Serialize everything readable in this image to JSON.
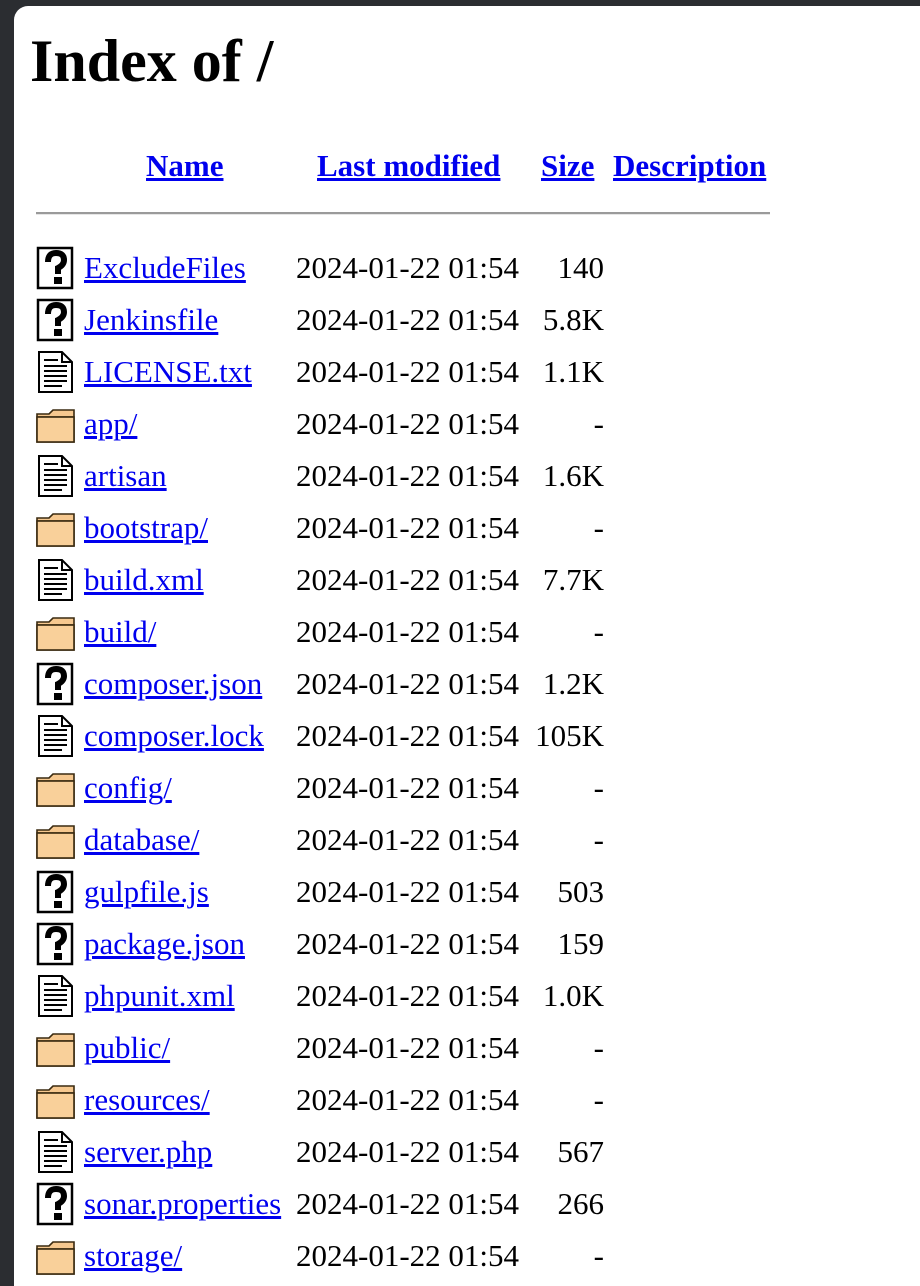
{
  "page": {
    "title": "Index of /"
  },
  "columns": {
    "name": "Name",
    "last_modified": "Last modified",
    "size": "Size",
    "description": "Description"
  },
  "entries": [
    {
      "name": "ExcludeFiles",
      "modified": "2024-01-22 01:54",
      "size": "140",
      "icon": "unknown-file-icon"
    },
    {
      "name": "Jenkinsfile",
      "modified": "2024-01-22 01:54",
      "size": "5.8K",
      "icon": "unknown-file-icon"
    },
    {
      "name": "LICENSE.txt",
      "modified": "2024-01-22 01:54",
      "size": "1.1K",
      "icon": "text-file-icon"
    },
    {
      "name": "app/",
      "modified": "2024-01-22 01:54",
      "size": "-",
      "icon": "folder-icon"
    },
    {
      "name": "artisan",
      "modified": "2024-01-22 01:54",
      "size": "1.6K",
      "icon": "text-file-icon"
    },
    {
      "name": "bootstrap/",
      "modified": "2024-01-22 01:54",
      "size": "-",
      "icon": "folder-icon"
    },
    {
      "name": "build.xml",
      "modified": "2024-01-22 01:54",
      "size": "7.7K",
      "icon": "text-file-icon"
    },
    {
      "name": "build/",
      "modified": "2024-01-22 01:54",
      "size": "-",
      "icon": "folder-icon"
    },
    {
      "name": "composer.json",
      "modified": "2024-01-22 01:54",
      "size": "1.2K",
      "icon": "unknown-file-icon"
    },
    {
      "name": "composer.lock",
      "modified": "2024-01-22 01:54",
      "size": "105K",
      "icon": "text-file-icon"
    },
    {
      "name": "config/",
      "modified": "2024-01-22 01:54",
      "size": "-",
      "icon": "folder-icon"
    },
    {
      "name": "database/",
      "modified": "2024-01-22 01:54",
      "size": "-",
      "icon": "folder-icon"
    },
    {
      "name": "gulpfile.js",
      "modified": "2024-01-22 01:54",
      "size": "503",
      "icon": "unknown-file-icon"
    },
    {
      "name": "package.json",
      "modified": "2024-01-22 01:54",
      "size": "159",
      "icon": "unknown-file-icon"
    },
    {
      "name": "phpunit.xml",
      "modified": "2024-01-22 01:54",
      "size": "1.0K",
      "icon": "text-file-icon"
    },
    {
      "name": "public/",
      "modified": "2024-01-22 01:54",
      "size": "-",
      "icon": "folder-icon"
    },
    {
      "name": "resources/",
      "modified": "2024-01-22 01:54",
      "size": "-",
      "icon": "folder-icon"
    },
    {
      "name": "server.php",
      "modified": "2024-01-22 01:54",
      "size": "567",
      "icon": "text-file-icon"
    },
    {
      "name": "sonar.properties",
      "modified": "2024-01-22 01:54",
      "size": "266",
      "icon": "unknown-file-icon"
    },
    {
      "name": "storage/",
      "modified": "2024-01-22 01:54",
      "size": "-",
      "icon": "folder-icon"
    }
  ]
}
